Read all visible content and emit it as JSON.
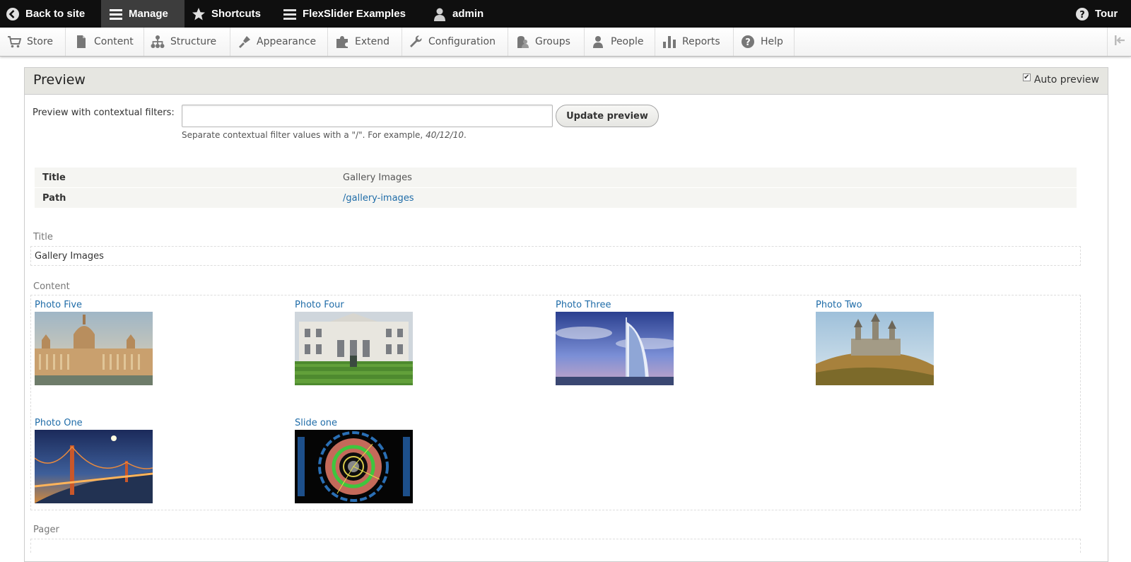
{
  "toolbar": {
    "back_to_site": "Back to site",
    "manage": "Manage",
    "shortcuts": "Shortcuts",
    "flexslider": "FlexSlider Examples",
    "user": "admin",
    "tour": "Tour"
  },
  "tray": {
    "items": [
      {
        "label": "Store",
        "icon": "cart-icon"
      },
      {
        "label": "Content",
        "icon": "document-icon"
      },
      {
        "label": "Structure",
        "icon": "sitemap-icon"
      },
      {
        "label": "Appearance",
        "icon": "brush-icon"
      },
      {
        "label": "Extend",
        "icon": "puzzle-icon"
      },
      {
        "label": "Configuration",
        "icon": "wrench-icon"
      },
      {
        "label": "Groups",
        "icon": "groups-icon"
      },
      {
        "label": "People",
        "icon": "people-icon"
      },
      {
        "label": "Reports",
        "icon": "bar-chart-icon"
      },
      {
        "label": "Help",
        "icon": "help-icon"
      }
    ]
  },
  "preview": {
    "title": "Preview",
    "auto_preview_label": "Auto preview",
    "auto_preview_checked": true,
    "contextual_label": "Preview with contextual filters:",
    "contextual_value": "",
    "update_button": "Update preview",
    "description_prefix": "Separate contextual filter values with a \"/\". For example, ",
    "description_example": "40/12/10",
    "description_suffix": "."
  },
  "info": {
    "rows": [
      {
        "key": "Title",
        "value": "Gallery Images"
      },
      {
        "key": "Path",
        "value": "/gallery-images"
      }
    ]
  },
  "title_section": {
    "label": "Title",
    "value": "Gallery Images"
  },
  "content_section": {
    "label": "Content",
    "items": [
      {
        "caption": "Photo Five"
      },
      {
        "caption": "Photo Four"
      },
      {
        "caption": "Photo Three"
      },
      {
        "caption": "Photo Two"
      },
      {
        "caption": "Photo One"
      },
      {
        "caption": "Slide one"
      }
    ]
  },
  "pager_section": {
    "label": "Pager"
  },
  "colors": {
    "link": "#1f6ca8",
    "toolbar_bg": "#0f0f0f",
    "panel_head_bg": "#e6e6e1"
  }
}
